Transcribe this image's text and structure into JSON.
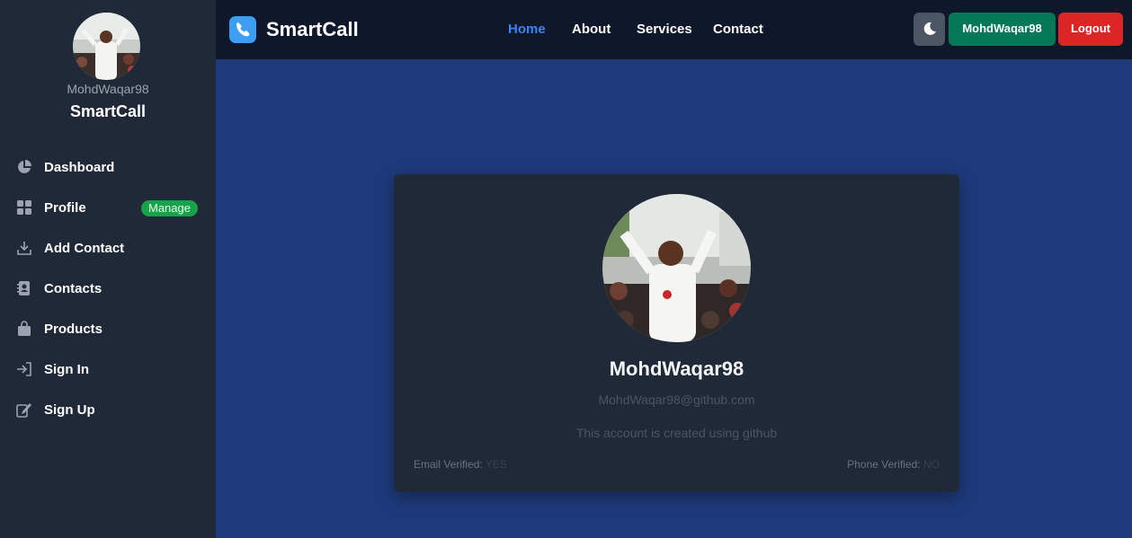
{
  "sidebar": {
    "username": "MohdWaqar98",
    "brand": "SmartCall",
    "items": [
      {
        "label": "Dashboard",
        "icon": "pie-chart-icon"
      },
      {
        "label": "Profile",
        "icon": "grid-icon",
        "badge": "Manage"
      },
      {
        "label": "Add Contact",
        "icon": "download-icon"
      },
      {
        "label": "Contacts",
        "icon": "address-book-icon"
      },
      {
        "label": "Products",
        "icon": "shopping-bag-icon"
      },
      {
        "label": "Sign In",
        "icon": "sign-in-icon"
      },
      {
        "label": "Sign Up",
        "icon": "edit-icon"
      }
    ]
  },
  "navbar": {
    "brand": "SmartCall",
    "links": [
      "Home",
      "About",
      "Services",
      "Contact"
    ],
    "active_link": "Home",
    "theme_icon": "moon-icon",
    "user_button": "MohdWaqar98",
    "logout_button": "Logout"
  },
  "profile": {
    "name": "MohdWaqar98",
    "email": "MohdWaqar98@github.com",
    "description": "This account is created using github",
    "email_verified_label": "Email Verified:",
    "email_verified_value": "YES",
    "phone_verified_label": "Phone Verified:",
    "phone_verified_value": "NO"
  },
  "colors": {
    "main_bg": "#1e3a7b",
    "sidebar_bg": "#1f2937",
    "navbar_bg": "#0f172a",
    "active_link": "#3b82f6",
    "badge": "#16a34a",
    "user_button": "#047857",
    "logout_button": "#dc2626"
  }
}
